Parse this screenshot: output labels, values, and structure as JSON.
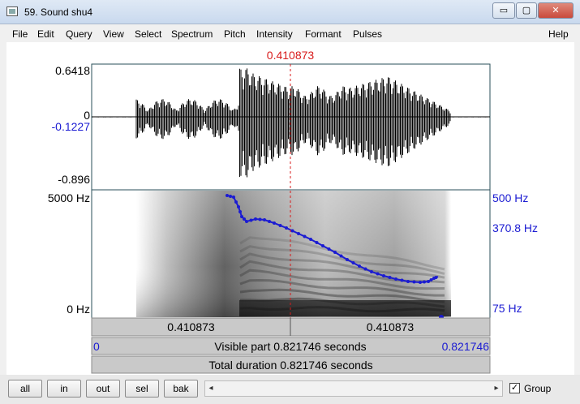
{
  "window": {
    "title": "59. Sound shu4",
    "minimize_glyph": "▭",
    "maximize_glyph": "▢",
    "close_glyph": "✕",
    "close_color": "#c94a3c"
  },
  "menu": {
    "items": [
      "File",
      "Edit",
      "Query",
      "View",
      "Select",
      "Spectrum",
      "Pitch",
      "Intensity",
      "Formant",
      "Pulses"
    ],
    "help": "Help"
  },
  "cursor": {
    "time_label": "0.410873"
  },
  "waveform": {
    "y_max": "0.6418",
    "y_zero": "0",
    "y_cursor": "-0.1227",
    "y_min": "-0.896"
  },
  "spectrogram": {
    "freq_top": "5000 Hz",
    "freq_bottom": "0 Hz",
    "pitch_top": "500 Hz",
    "pitch_cursor": "370.8 Hz",
    "pitch_bottom": "75 Hz"
  },
  "time_bar": {
    "left_segment": "0.410873",
    "right_segment": "0.410873",
    "visible_start": "0",
    "visible_label": "Visible part 0.821746 seconds",
    "visible_end": "0.821746",
    "total_label": "Total duration 0.821746 seconds"
  },
  "bottom": {
    "buttons": [
      "all",
      "in",
      "out",
      "sel",
      "bak"
    ],
    "scroll_left": "◂",
    "scroll_right": "▸",
    "group_label": "Group",
    "group_checked": "✓"
  },
  "colors": {
    "pitch_line": "#1b1bd2",
    "cursor_line": "#d81b1b",
    "label_blue": "#1b1bd2"
  }
}
